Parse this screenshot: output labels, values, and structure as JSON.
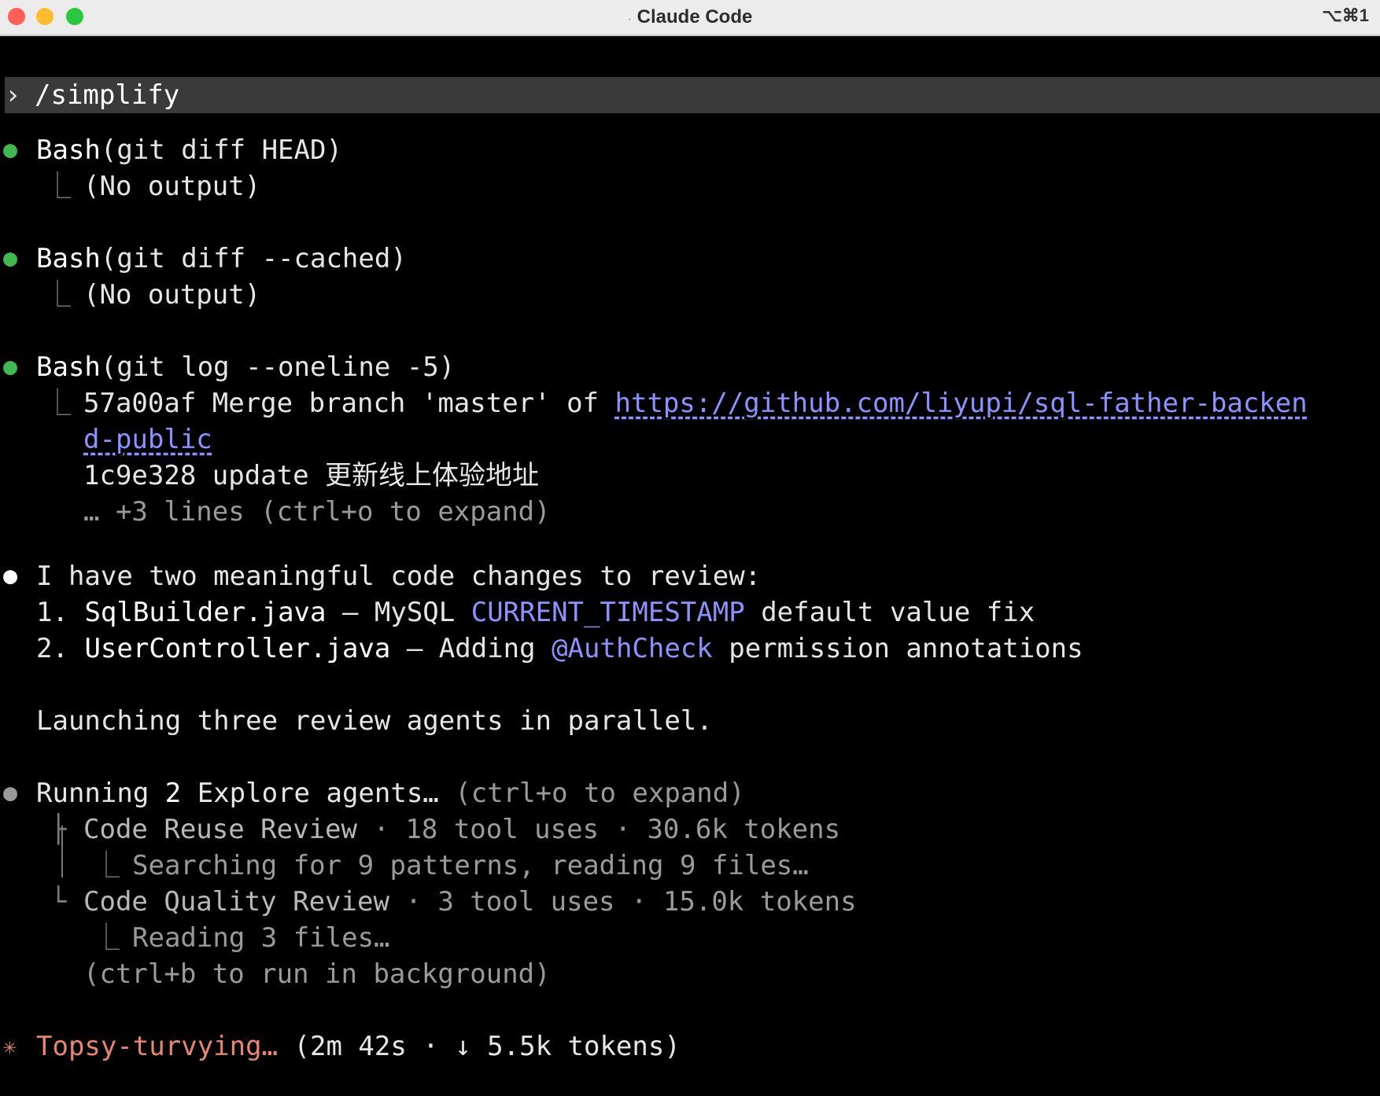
{
  "window": {
    "title": "Claude Code",
    "title_prefix": "·",
    "shortcut": "⌥⌘1",
    "traffic_lights": {
      "close": "#ff5f57",
      "minimize": "#febc2e",
      "zoom": "#28c840"
    }
  },
  "prompt": {
    "marker": "›",
    "command": "/simplify"
  },
  "tool_calls": [
    {
      "tool": "Bash",
      "args": "(git diff HEAD)",
      "output": "(No output)"
    },
    {
      "tool": "Bash",
      "args": "(git diff --cached)",
      "output": "(No output)"
    },
    {
      "tool": "Bash",
      "args": "(git log --oneline -5)",
      "output_line1_prefix": "57a00af Merge branch 'master' of ",
      "output_link_part1": "https://github.com/liyupi/sql-father-backen",
      "output_link_part2": "d-public",
      "output_line2": "1c9e328 update 更新线上体验地址",
      "output_more": "… +3 lines (ctrl+o to expand)"
    }
  ],
  "message": {
    "intro": "I have two meaningful code changes to review:",
    "items": [
      {
        "num": "1.",
        "file": "SqlBuilder.java",
        "dash": " – MySQL ",
        "highlight": "CURRENT_TIMESTAMP",
        "rest": " default value fix"
      },
      {
        "num": "2.",
        "file": "UserController.java",
        "dash": " – Adding ",
        "highlight": "@AuthCheck",
        "rest": " permission annotations"
      }
    ],
    "launching": "Launching three review agents in parallel."
  },
  "agents": {
    "header_prefix": "Running ",
    "count": "2",
    "header_suffix": " Explore agents… ",
    "expand_hint": "(ctrl+o to expand)",
    "list": [
      {
        "name": "Code Reuse Review",
        "stats": " · 18 tool uses · 30.6k tokens",
        "activity": "Searching for 9 patterns, reading 9 files…"
      },
      {
        "name": "Code Quality Review",
        "stats": " · 3 tool uses · 15.0k tokens",
        "activity": "Reading 3 files…"
      }
    ],
    "background_hint": "(ctrl+b to run in background)"
  },
  "status": {
    "spinner": "✳",
    "verb": "Topsy-turvying…",
    "details": " (2m 42s · ↓ 5.5k tokens)"
  },
  "colors": {
    "bullet_success": "#3fb950",
    "accent_blue": "#8c93ff",
    "status_orange": "#e9866f",
    "bullet_running": "#9a9a9a"
  }
}
